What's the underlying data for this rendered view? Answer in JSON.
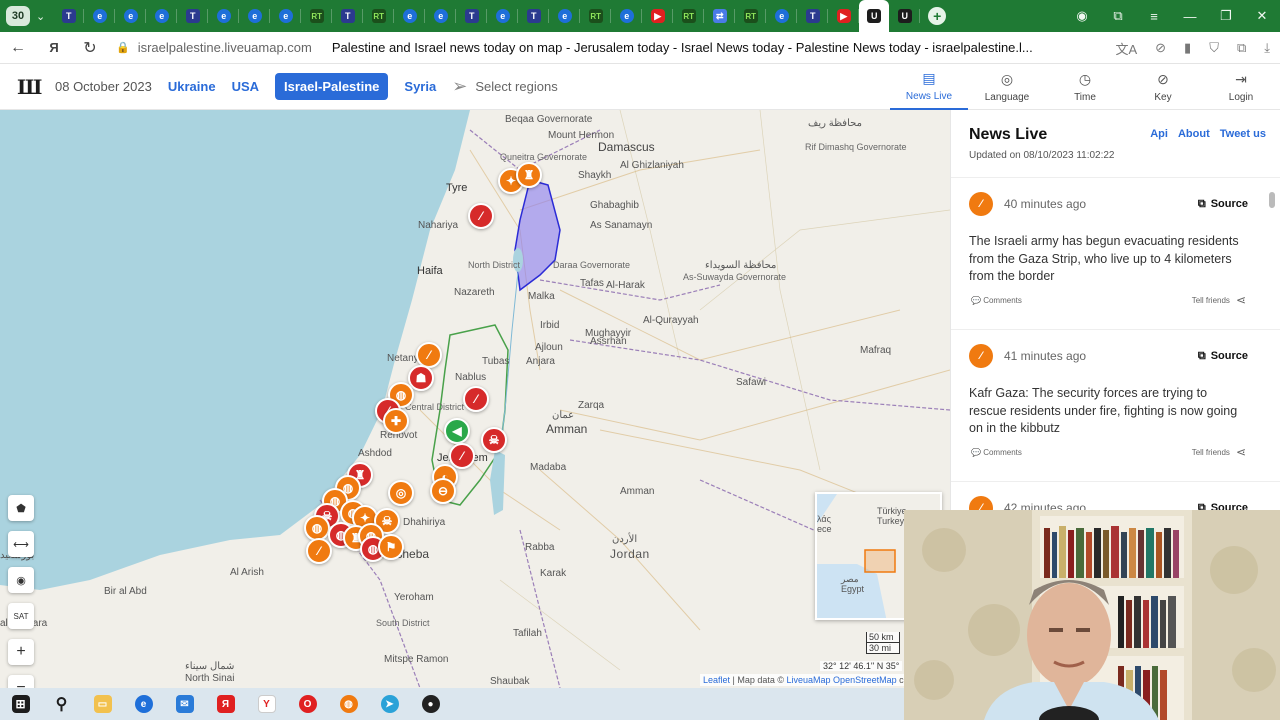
{
  "browser": {
    "tab_count": "30",
    "tab_favicons": [
      "T",
      "e",
      "e",
      "e",
      "T",
      "e",
      "e",
      "e",
      "rt",
      "T",
      "rt",
      "e",
      "e",
      "T",
      "e",
      "T",
      "e",
      "rt",
      "e",
      "yt",
      "rt",
      "tr",
      "rt",
      "e",
      "T",
      "yt"
    ],
    "url": "israelpalestine.liveuamap.com",
    "page_title": "Palestine and Israel news today on map - Jerusalem today - Israel News today - Palestine News today - israelpalestine.l..."
  },
  "header": {
    "date": "08 October 2023",
    "regions": [
      {
        "label": "Ukraine",
        "active": false
      },
      {
        "label": "USA",
        "active": false
      },
      {
        "label": "Israel-Palestine",
        "active": true
      },
      {
        "label": "Syria",
        "active": false
      }
    ],
    "select_regions_label": "Select regions",
    "menu": [
      {
        "label": "News Live",
        "icon": "news-icon",
        "glyph": "▤",
        "active": true
      },
      {
        "label": "Language",
        "icon": "globe-icon",
        "glyph": "◎",
        "active": false
      },
      {
        "label": "Time",
        "icon": "clock-icon",
        "glyph": "◷",
        "active": false
      },
      {
        "label": "Key",
        "icon": "compass-icon",
        "glyph": "⊘",
        "active": false
      },
      {
        "label": "Login",
        "icon": "login-icon",
        "glyph": "⇥",
        "active": false
      }
    ]
  },
  "map": {
    "labels": {
      "beqaa": "Beqaa Governorate",
      "mt_hermon": "Mount Hermon",
      "damascus": "Damascus",
      "al_ghizlaniyah": "Al Ghizlaniyah",
      "rif_dimashq": "Rif Dimashq Governorate",
      "rif_dimashq_ar": "محافظة ريف",
      "quneitra": "Quneitra Governorate",
      "shaykh": "Shaykh",
      "ghabaghib": "Ghabaghib",
      "as_sanamayn": "As Sanamayn",
      "tyre": "Tyre",
      "nahariya": "Nahariya",
      "haifa": "Haifa",
      "nazareth": "Nazareth",
      "north_district": "North District",
      "daraa": "Daraa Governorate",
      "as_suwayda": "As-Suwayda Governorate",
      "suwayda_ar": "محافظة السويداء",
      "al_harak": "Al-Harak",
      "tafas": "Tafas",
      "irbid": "Irbid",
      "malka": "Malka",
      "al_qurayyah": "Al-Qurayyah",
      "mughayyir": "Mughayyir",
      "assrhan": "Assrhan",
      "mafraq": "Mafraq",
      "safawi": "Safawi",
      "netanya": "Netanya",
      "tubas": "Tubas",
      "ajloun": "Ajloun",
      "anjara": "Anjara",
      "nablus": "Nablus",
      "zarqa": "Zarqa",
      "rehovot": "Rehovot",
      "central_district": "Central District",
      "amman": "Amman",
      "amman_ar": "عمان",
      "jerusalem": "Jerusalem",
      "ashdod": "Ashdod",
      "dhahiriya": "Dhahiriya",
      "madaba": "Madaba",
      "amman_gov": "Amman",
      "beersheba": "Beersheba",
      "al_arish": "Al Arish",
      "bir_al_abd": "Bir al Abd",
      "rabba": "Rabba",
      "jordan": "Jordan",
      "jordan_ar": "الأردن",
      "karak": "Karak",
      "yeroham": "Yeroham",
      "south_district": "South District",
      "tafilah": "Tafilah",
      "mitspe_ramon": "Mitspe Ramon",
      "shaubak": "Shaubak",
      "north_sinai": "North Sinai",
      "qantara": "al-Qantara",
      "port_said_ar": "بورسعيد",
      "sinai_ar": "شمال سيناء"
    },
    "controls": [
      "⬟",
      "⟷",
      "◉",
      "SAT",
      "+",
      "−"
    ],
    "inset_labels": {
      "turkey": "Türkiye\nTurkey",
      "egypt": "مصر\nEgypt",
      "greece": "λάς\nece"
    },
    "scale": {
      "km": "50 km",
      "mi": "30 mi"
    },
    "coords": "32° 12' 46.1'' N 35°",
    "attribution_prefix": "Leaflet",
    "attribution_mid": " | Map data © ",
    "attribution_link": "LiveuaMap OpenStreetMap",
    "attribution_suffix": " c"
  },
  "news": {
    "title": "News Live",
    "updated": "Updated on 08/10/2023 11:02:22",
    "links": [
      "Api",
      "About",
      "Tweet us"
    ],
    "items": [
      {
        "time": "40 minutes ago",
        "source_label": "Source",
        "text": "The Israeli army has begun evacuating residents from the Gaza Strip, who live up to 4 kilometers from the border",
        "comments_label": "Comments",
        "tell_friends_label": "Tell friends"
      },
      {
        "time": "41 minutes ago",
        "source_label": "Source",
        "text": "Kafr Gaza: The security forces are trying to rescue residents under fire, fighting is now going on in the kibbutz",
        "comments_label": "Comments",
        "tell_friends_label": "Tell friends"
      },
      {
        "time": "42 minutes ago",
        "source_label": "Source",
        "text": "",
        "comments_label": "",
        "tell_friends_label": ""
      }
    ]
  },
  "colors": {
    "tabbar": "#1f7a34",
    "accent": "#2a6bd8",
    "marker_orange": "#f07a10",
    "marker_red": "#d62a2a",
    "marker_green": "#2aa84a",
    "golan_fill": "#8b7cf0"
  }
}
